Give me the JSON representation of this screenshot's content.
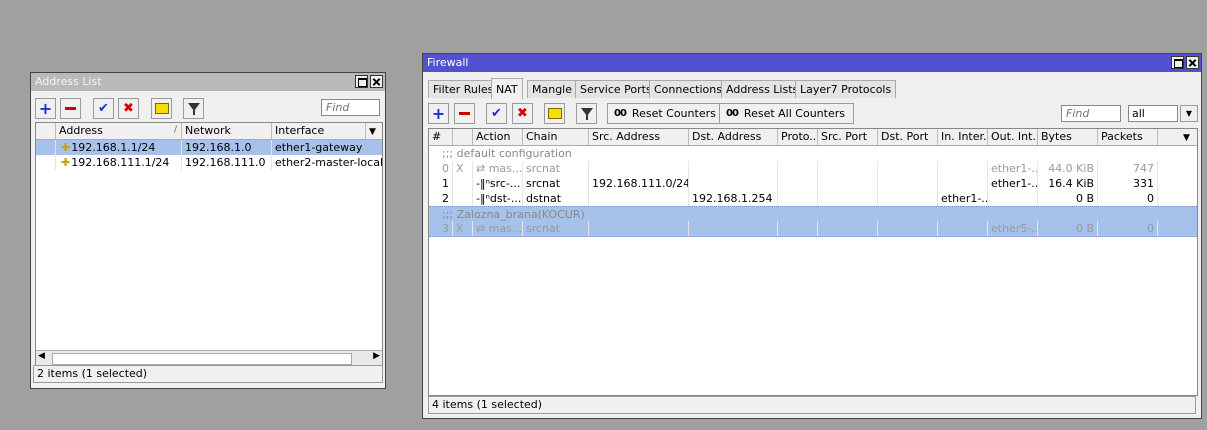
{
  "address_list": {
    "title": "Address List",
    "find_placeholder": "Find",
    "columns": [
      "Address",
      "Network",
      "Interface"
    ],
    "sort_indicator": "/",
    "rows": [
      {
        "address": "192.168.1.1/24",
        "network": "192.168.1.0",
        "interface": "ether1-gateway",
        "selected": true
      },
      {
        "address": "192.168.111.1/24",
        "network": "192.168.111.0",
        "interface": "ether2-master-local",
        "selected": false
      }
    ],
    "status": "2 items (1 selected)"
  },
  "firewall": {
    "title": "Firewall",
    "tabs": [
      "Filter Rules",
      "NAT",
      "Mangle",
      "Service Ports",
      "Connections",
      "Address Lists",
      "Layer7 Protocols"
    ],
    "active_tab": "NAT",
    "toolbar": {
      "reset_counters": "Reset Counters",
      "reset_all_counters": "Reset All Counters",
      "counter_icon_text": "00",
      "find_placeholder": "Find",
      "filter_value": "all"
    },
    "columns": [
      "#",
      "Action",
      "Chain",
      "Src. Address",
      "Dst. Address",
      "Proto...",
      "Src. Port",
      "Dst. Port",
      "In. Inter...",
      "Out. Int...",
      "Bytes",
      "Packets"
    ],
    "comment1": ";;; default configuration",
    "comment2": ";;; Zalozna_brana(KOCUR)",
    "rows": [
      {
        "num": "0",
        "flag": "X",
        "action": "mas...",
        "chain": "srcnat",
        "src": "",
        "dst": "",
        "in": "",
        "out": "ether1-...",
        "bytes": "44.0 KiB",
        "packets": "747"
      },
      {
        "num": "1",
        "flag": "",
        "action": "src-...",
        "chain": "srcnat",
        "src": "192.168.111.0/24",
        "dst": "",
        "in": "",
        "out": "ether1-...",
        "bytes": "16.4 KiB",
        "packets": "331"
      },
      {
        "num": "2",
        "flag": "",
        "action": "dst-...",
        "chain": "dstnat",
        "src": "",
        "dst": "192.168.1.254",
        "in": "ether1-...",
        "out": "",
        "bytes": "0 B",
        "packets": "0"
      },
      {
        "num": "3",
        "flag": "X",
        "action": "mas...",
        "chain": "srcnat",
        "src": "",
        "dst": "",
        "in": "",
        "out": "ether5-...",
        "bytes": "0 B",
        "packets": "0"
      }
    ],
    "status": "4 items (1 selected)"
  },
  "colors": {
    "accent": "#5252d0",
    "selection": "#a6c2eb",
    "desktop": "#a0a0a0"
  }
}
